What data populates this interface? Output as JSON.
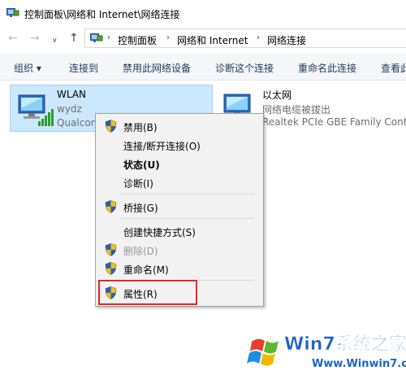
{
  "window": {
    "title": "控制面板\\网络和 Internet\\网络连接"
  },
  "nav": {
    "back": "←",
    "forward": "→",
    "dropdown": "∨",
    "up": "↑"
  },
  "address": {
    "crumbs": [
      "控制面板",
      "网络和 Internet",
      "网络连接"
    ],
    "separator": "›"
  },
  "toolbar": {
    "organize": "组织 ▾",
    "connect_to": "连接到",
    "disable_device": "禁用此网络设备",
    "diagnose": "诊断这个连接",
    "rename": "重命名此连接",
    "view_status": "查看此"
  },
  "connections": [
    {
      "name": "WLAN",
      "sub1": "wydz",
      "sub2": "Qualcom"
    },
    {
      "name": "以太网",
      "sub1": "网络电缆被拔出",
      "sub2": "Realtek PCIe GBE Family Contr"
    }
  ],
  "context_menu": {
    "items": [
      {
        "label": "禁用(B)",
        "shield": true,
        "bold": false,
        "disabled": false
      },
      {
        "label": "连接/断开连接(O)",
        "shield": false,
        "bold": false,
        "disabled": false
      },
      {
        "label": "状态(U)",
        "shield": false,
        "bold": true,
        "disabled": false
      },
      {
        "label": "诊断(I)",
        "shield": false,
        "bold": false,
        "disabled": false
      },
      {
        "label": "桥接(G)",
        "shield": true,
        "bold": false,
        "disabled": false
      },
      {
        "label": "创建快捷方式(S)",
        "shield": false,
        "bold": false,
        "disabled": false
      },
      {
        "label": "删除(D)",
        "shield": true,
        "bold": false,
        "disabled": true
      },
      {
        "label": "重命名(M)",
        "shield": true,
        "bold": false,
        "disabled": false
      },
      {
        "label": "属性(R)",
        "shield": true,
        "bold": false,
        "disabled": false
      }
    ]
  },
  "watermark": {
    "brand_text": "Win7系统之家",
    "url": "Www.Winwin7.com"
  },
  "colors": {
    "selection": "#cce8ff",
    "toolbar_text": "#1e395b",
    "highlight_box": "#e22222"
  }
}
